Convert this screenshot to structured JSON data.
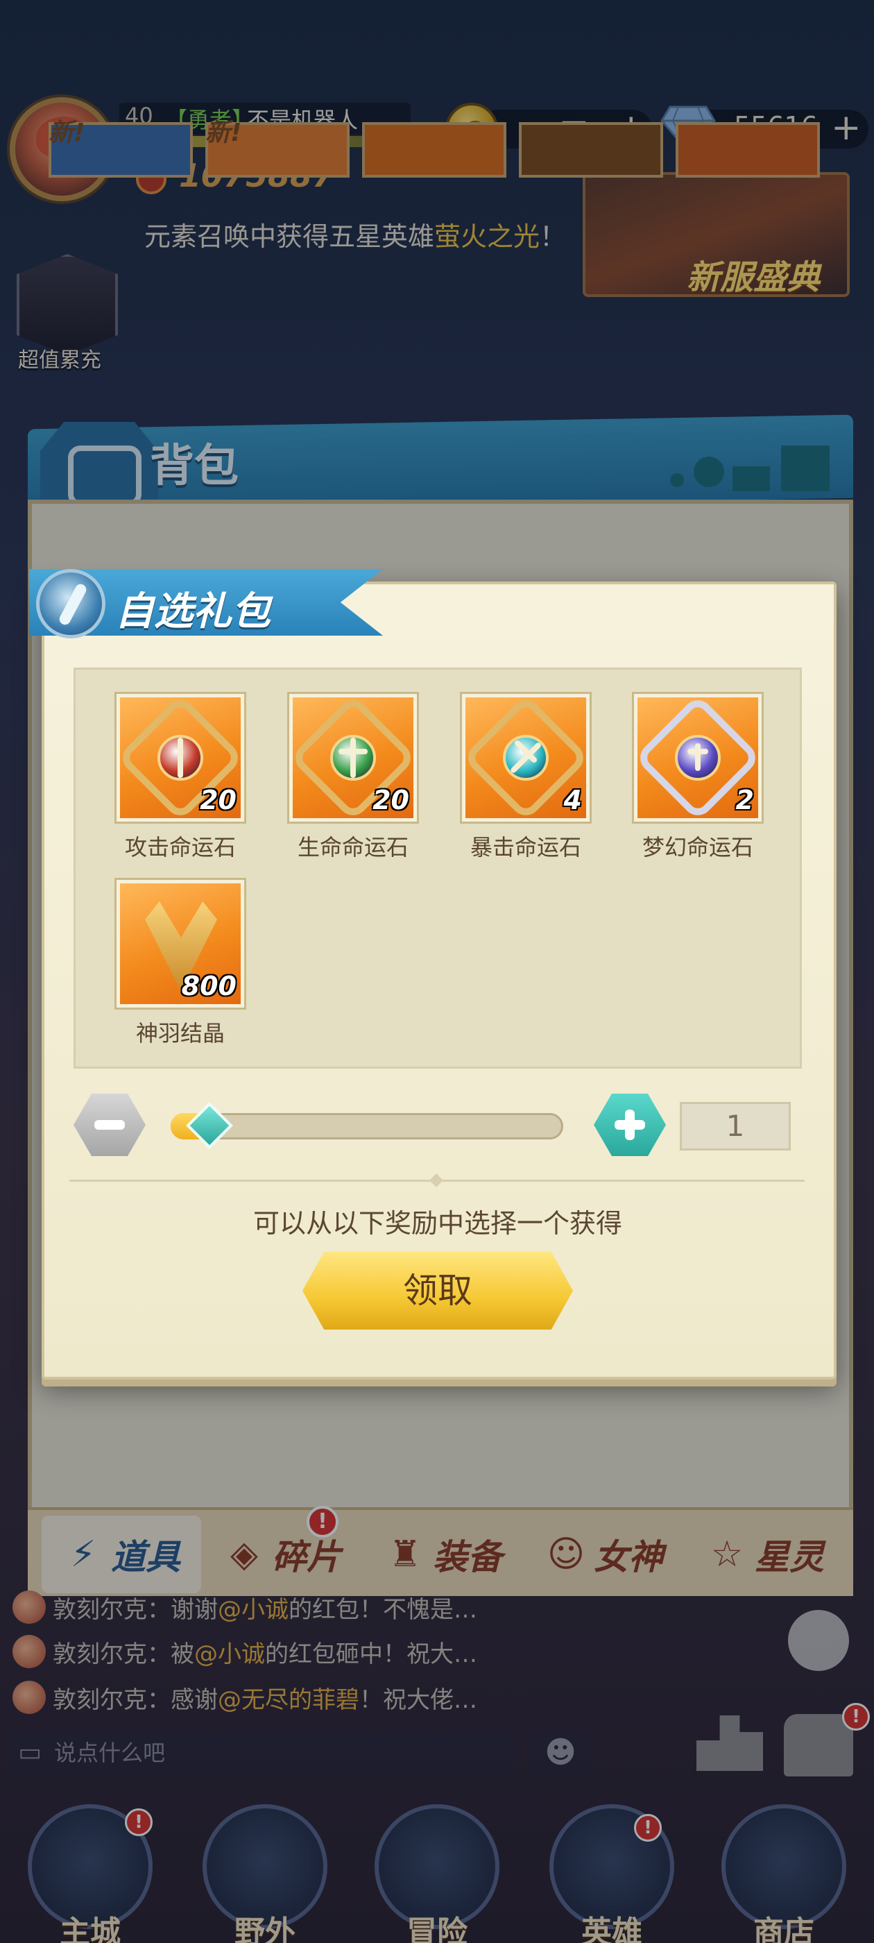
{
  "hud": {
    "level": "40",
    "rank_tag": "【勇者】",
    "player_name": "不是机器人",
    "xp_progress": 0.85,
    "power": "1075887",
    "coins": "14万",
    "coins_plus": "+",
    "gems": "55616",
    "gems_plus": "+"
  },
  "ticker": {
    "prefix": "元素召唤中获得五星英雄",
    "hero": "萤火之光",
    "suffix": "！"
  },
  "event_banner": "新服盛典",
  "side_hero_label": "超值累充",
  "bag": {
    "title": "背包",
    "slot_new_label": "新!",
    "tabs": [
      {
        "icon": "item-icon",
        "label": "道具",
        "active": true
      },
      {
        "icon": "shard-icon",
        "label": "碎片",
        "badge": "!"
      },
      {
        "icon": "equipment-icon",
        "label": "装备"
      },
      {
        "icon": "goddess-icon",
        "label": "女神"
      },
      {
        "icon": "star-spirit-icon",
        "label": "星灵"
      }
    ]
  },
  "modal": {
    "title": "自选礼包",
    "rewards": [
      {
        "name": "攻击命运石",
        "count": "20",
        "core_color": "#c43a2a"
      },
      {
        "name": "生命命运石",
        "count": "20",
        "core_color": "#3aa04a"
      },
      {
        "name": "暴击命运石",
        "count": "4",
        "core_color": "#2ab8c4"
      },
      {
        "name": "梦幻命运石",
        "count": "2",
        "core_color": "#5a4ac4"
      },
      {
        "name": "神羽结晶",
        "count": "800",
        "core_color": "#e2b866"
      }
    ],
    "quantity": "1",
    "slider_fraction": 0.0,
    "prompt": "可以从以下奖励中选择一个获得",
    "claim_label": "领取"
  },
  "chat": {
    "lines": [
      {
        "speaker": "敦刻尔克：",
        "pre": "谢谢",
        "mention": "@小诚",
        "post": " 的红包！不愧是…"
      },
      {
        "speaker": "敦刻尔克：",
        "pre": "被",
        "mention": "@小诚",
        "post": " 的红包砸中！祝大…"
      },
      {
        "speaker": "敦刻尔克：",
        "pre": "感谢",
        "mention": "@无尽的菲碧",
        "post": "！祝大佬…"
      }
    ],
    "input_placeholder": "说点什么吧",
    "emoji_glyph": "☻"
  },
  "nav": [
    {
      "label": "主城",
      "badge": "!"
    },
    {
      "label": "野外"
    },
    {
      "label": "冒险"
    },
    {
      "label": "英雄",
      "badge": "!"
    },
    {
      "label": "商店"
    }
  ],
  "colors": {
    "accent_blue": "#2a82b8",
    "gold": "#f6c834",
    "highlight_text": "#f0c440"
  }
}
